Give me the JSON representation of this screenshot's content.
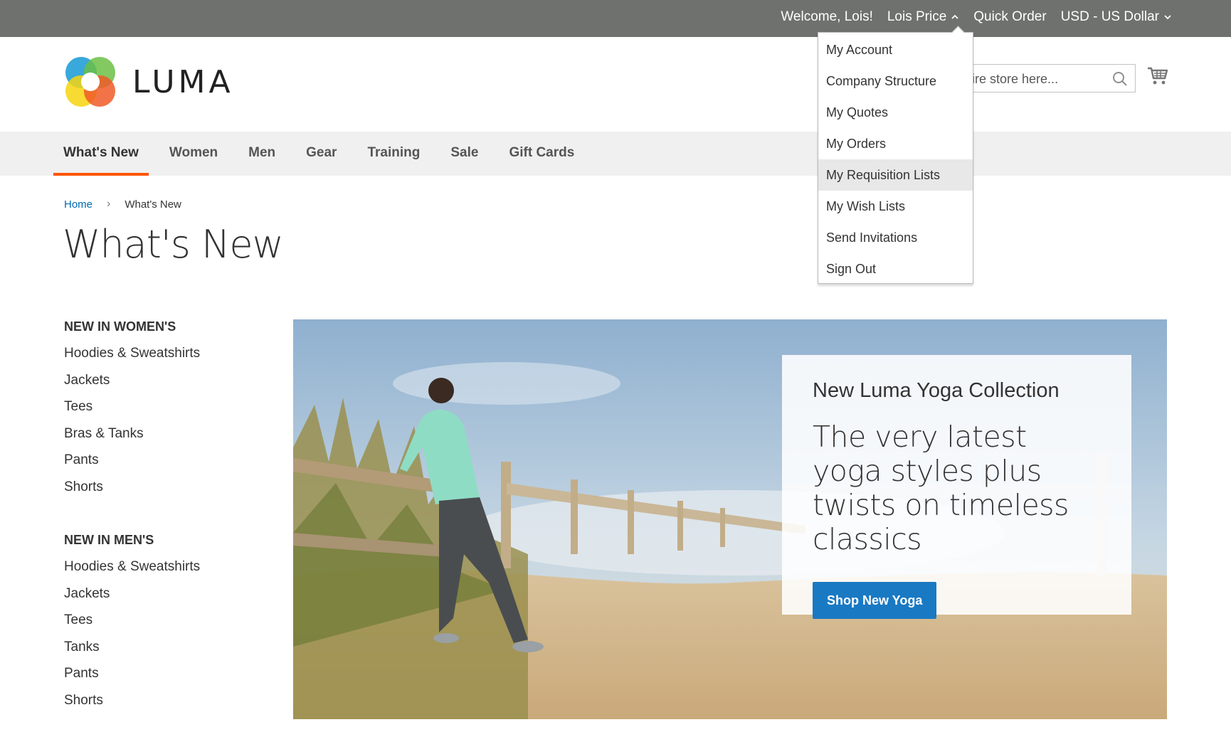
{
  "panel": {
    "welcome": "Welcome, Lois!",
    "customer_name": "Lois Price",
    "quick_order": "Quick Order",
    "currency": "USD - US Dollar"
  },
  "account_menu": {
    "items": [
      "My Account",
      "Company Structure",
      "My Quotes",
      "My Orders",
      "My Requisition Lists",
      "My Wish Lists",
      "Send Invitations",
      "Sign Out"
    ],
    "highlighted": "My Requisition Lists"
  },
  "header": {
    "logo_text": "LUMA",
    "search_placeholder": "ntire store here..."
  },
  "nav": {
    "items": [
      "What's New",
      "Women",
      "Men",
      "Gear",
      "Training",
      "Sale",
      "Gift Cards"
    ],
    "active": "What's New"
  },
  "breadcrumbs": {
    "home": "Home",
    "current": "What's New"
  },
  "page_title": "What's New",
  "sidebar": {
    "women": {
      "title": "NEW IN WOMEN'S",
      "items": [
        "Hoodies & Sweatshirts",
        "Jackets",
        "Tees",
        "Bras & Tanks",
        "Pants",
        "Shorts"
      ]
    },
    "men": {
      "title": "NEW IN MEN'S",
      "items": [
        "Hoodies & Sweatshirts",
        "Jackets",
        "Tees",
        "Tanks",
        "Pants",
        "Shorts"
      ]
    }
  },
  "promo": {
    "subtitle": "New Luma Yoga Collection",
    "title": "The very latest yoga styles plus twists on timeless classics",
    "button": "Shop New Yoga"
  },
  "colors": {
    "accent": "#ff5501",
    "link": "#006bb4",
    "button": "#1979c3",
    "panel": "#6e716e"
  }
}
